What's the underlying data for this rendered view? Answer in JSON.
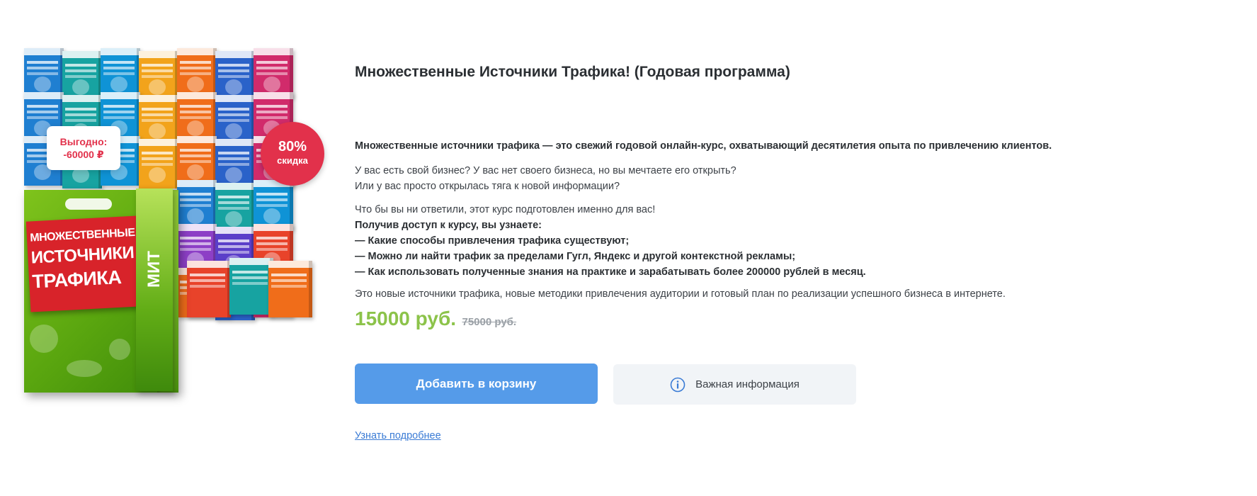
{
  "product": {
    "title": "Множественные Источники Трафика! (Годовая программа)",
    "lead": "Множественные источники трафика — это свежий годовой онлайн-курс, охватывающий десятилетия опыта по привлечению клиентов.",
    "question_line_1": "У вас есть свой бизнес? У вас нет своего бизнеса, но вы мечтаете его открыть?",
    "question_line_2": "Или у вас просто открылась тяга к новой информации?",
    "answer_line": "Что бы вы ни ответили, этот курс подготовлен именно для вас!",
    "benefits_heading": "Получив доступ к курсу, вы узнаете:",
    "benefits": [
      "— Какие способы привлечения трафика существуют;",
      "— Можно ли найти трафик за пределами Гугл, Яндекс и другой контекстной рекламы;",
      "— Как использовать полученные знания на практике и зарабатывать более 200000 рублей в месяц."
    ],
    "summary": "Это новые источники трафика, новые методики привлечения аудитории и готовый план по реализации успешного бизнеса в интернете.",
    "price_new": "15000 руб.",
    "price_old": "75000 руб."
  },
  "image": {
    "cover_title_line_1": "Множественные",
    "cover_title_line_2": "Источники",
    "cover_title_line_3": "Трафика",
    "side_label": "МИТ",
    "profit_label": "Выгодно:",
    "profit_value": "-60000 ₽",
    "discount_percent": "80%",
    "discount_label": "скидка",
    "box_colors": [
      "#1f7fd1",
      "#2a62c9",
      "#e8432a",
      "#f2a31b",
      "#8d3fc6",
      "#17a3a1",
      "#d12b6b",
      "#3aa24a",
      "#f06d1a",
      "#5b3fc9",
      "#0f93d6",
      "#c92f2f"
    ]
  },
  "actions": {
    "add_to_cart": "Добавить в корзину",
    "important_info": "Важная информация",
    "learn_more": "Узнать подробнее"
  },
  "colors": {
    "primary_button": "#559be9",
    "secondary_button": "#f1f4f7",
    "price": "#8cc34a",
    "badge_red": "#e2314b"
  }
}
